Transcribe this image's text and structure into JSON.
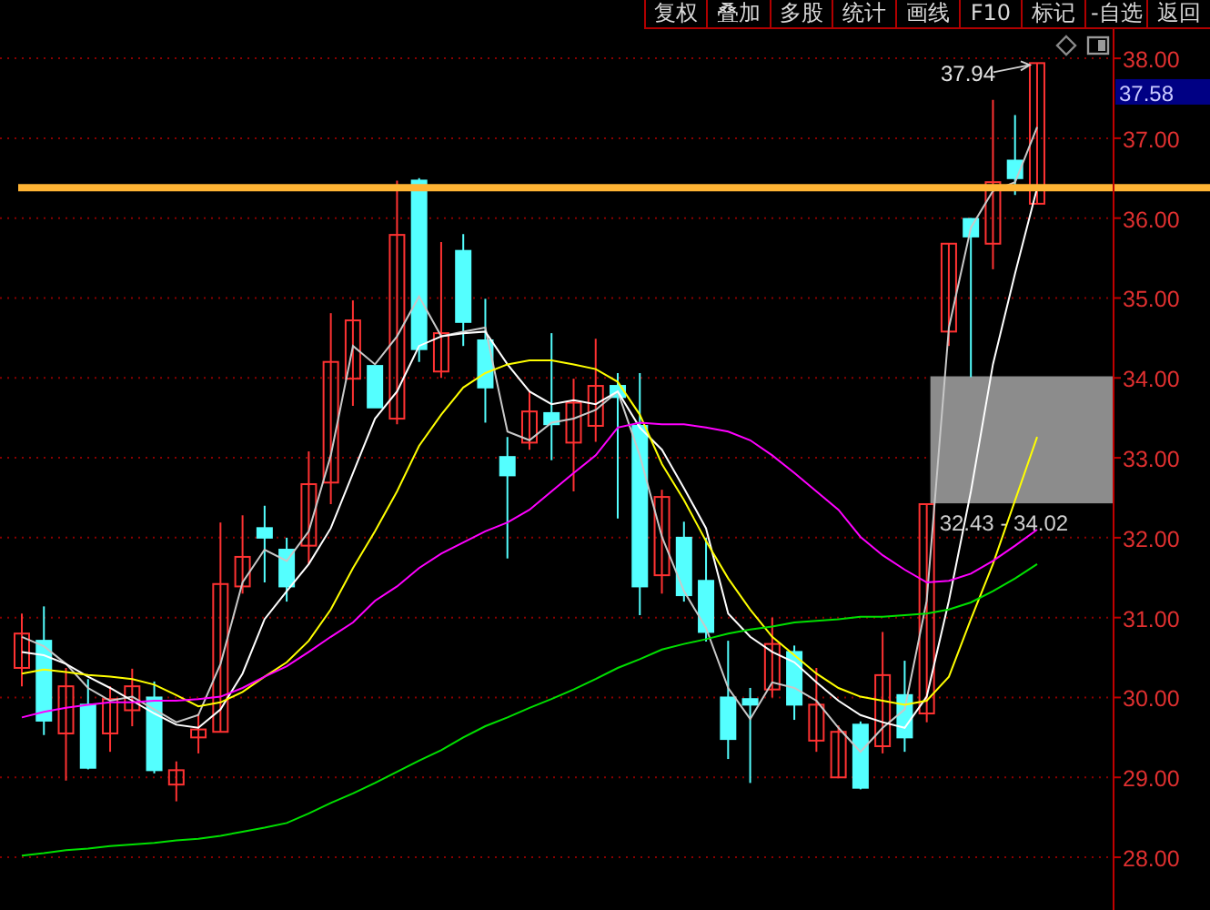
{
  "toolbar": [
    "复权",
    "叠加",
    "多股",
    "统计",
    "画线",
    "F10",
    "标记",
    "-自选",
    "返回"
  ],
  "chart_data": {
    "type": "candlestick",
    "ylim": [
      27.34,
      38.73
    ],
    "grid": true,
    "ref_lines": [
      {
        "axis": "y",
        "value": 36.38,
        "color": "#ffb434"
      }
    ],
    "bands": [
      {
        "axis": "y",
        "from": 32.43,
        "to": 34.02,
        "label": "32.43 - 34.02"
      }
    ],
    "yticks": [
      {
        "value": 28,
        "label": "28.00"
      },
      {
        "value": 29,
        "label": "29.00"
      },
      {
        "value": 30,
        "label": "30.00"
      },
      {
        "value": 31,
        "label": "31.00"
      },
      {
        "value": 32,
        "label": "32.00"
      },
      {
        "value": 33,
        "label": "33.00"
      },
      {
        "value": 34,
        "label": "34.00"
      },
      {
        "value": 35,
        "label": "35.00"
      },
      {
        "value": 36,
        "label": "36.00"
      },
      {
        "value": 37,
        "label": "37.00"
      },
      {
        "value": 38,
        "label": "38.00"
      }
    ],
    "ohlc": [
      [
        30.37,
        31.05,
        30.14,
        30.8
      ],
      [
        30.71,
        31.14,
        29.53,
        29.71
      ],
      [
        29.55,
        30.37,
        28.96,
        30.14
      ],
      [
        29.91,
        30.23,
        29.1,
        29.12
      ],
      [
        29.55,
        30.14,
        29.32,
        29.98
      ],
      [
        29.84,
        30.36,
        29.64,
        30.14
      ],
      [
        30.0,
        30.2,
        29.05,
        29.09
      ],
      [
        28.91,
        29.2,
        28.7,
        29.09
      ],
      [
        29.5,
        29.8,
        29.3,
        29.6
      ],
      [
        29.57,
        32.19,
        29.57,
        31.42
      ],
      [
        31.39,
        32.28,
        31.3,
        31.76
      ],
      [
        32.12,
        32.4,
        31.44,
        32.0
      ],
      [
        31.85,
        32.0,
        31.2,
        31.39
      ],
      [
        31.9,
        33.08,
        31.67,
        32.67
      ],
      [
        32.69,
        34.81,
        32.42,
        34.2
      ],
      [
        33.99,
        34.97,
        33.65,
        34.72
      ],
      [
        34.15,
        34.15,
        33.63,
        33.63
      ],
      [
        33.49,
        36.47,
        33.42,
        35.79
      ],
      [
        36.47,
        36.5,
        34.2,
        34.36
      ],
      [
        34.08,
        35.7,
        34.0,
        34.56
      ],
      [
        35.59,
        35.8,
        34.4,
        34.7
      ],
      [
        34.47,
        34.99,
        33.44,
        33.88
      ],
      [
        33.01,
        33.26,
        31.74,
        32.78
      ],
      [
        33.19,
        33.84,
        33.1,
        33.58
      ],
      [
        33.56,
        34.56,
        32.97,
        33.42
      ],
      [
        33.19,
        33.99,
        32.58,
        33.69
      ],
      [
        33.4,
        34.49,
        33.2,
        33.9
      ],
      [
        33.9,
        34.06,
        32.24,
        33.76
      ],
      [
        33.4,
        34.06,
        31.03,
        31.39
      ],
      [
        31.53,
        32.6,
        31.3,
        32.51
      ],
      [
        32.0,
        32.2,
        31.2,
        31.28
      ],
      [
        31.46,
        32.0,
        30.7,
        30.82
      ],
      [
        30.0,
        30.71,
        29.23,
        29.48
      ],
      [
        29.98,
        30.12,
        28.93,
        29.91
      ],
      [
        30.1,
        31.0,
        30.0,
        30.67
      ],
      [
        30.57,
        30.65,
        29.72,
        29.91
      ],
      [
        29.46,
        30.37,
        29.32,
        29.91
      ],
      [
        29.0,
        29.65,
        28.99,
        29.57
      ],
      [
        29.66,
        29.7,
        28.85,
        28.87
      ],
      [
        29.39,
        30.82,
        29.3,
        30.28
      ],
      [
        30.03,
        30.46,
        29.32,
        29.5
      ],
      [
        29.8,
        32.42,
        29.69,
        32.42
      ],
      [
        34.58,
        35.68,
        34.4,
        35.68
      ],
      [
        35.99,
        36.0,
        34.01,
        35.77
      ],
      [
        35.68,
        37.48,
        35.36,
        36.45
      ],
      [
        36.72,
        37.29,
        36.29,
        36.5
      ],
      [
        36.18,
        37.94,
        36.18,
        37.94
      ]
    ],
    "series": [
      {
        "type": "line",
        "color": "#c8c8c8",
        "values": [
          30.76,
          30.64,
          30.42,
          30.12,
          29.96,
          30.01,
          29.85,
          29.69,
          29.78,
          30.42,
          31.44,
          31.85,
          31.71,
          32.08,
          33.03,
          34.4,
          34.17,
          34.52,
          35.02,
          34.52,
          34.58,
          34.63,
          33.33,
          33.22,
          33.44,
          33.49,
          33.6,
          33.83,
          33.03,
          32.01,
          31.33,
          30.87,
          30.12,
          29.73,
          30.19,
          30.12,
          29.96,
          29.62,
          29.32,
          29.62,
          29.85,
          31.21,
          34.63,
          35.88,
          36.34,
          36.45,
          37.14
        ]
      },
      {
        "type": "line",
        "color": "#ffffff",
        "values": [
          30.57,
          30.53,
          30.42,
          30.26,
          30.12,
          29.96,
          29.8,
          29.66,
          29.62,
          29.85,
          30.3,
          30.98,
          31.33,
          31.67,
          32.12,
          32.81,
          33.49,
          33.83,
          34.4,
          34.52,
          34.56,
          34.58,
          34.17,
          33.83,
          33.67,
          33.72,
          33.67,
          33.83,
          33.38,
          33.1,
          32.62,
          32.12,
          31.05,
          30.76,
          30.57,
          30.44,
          30.19,
          29.96,
          29.78,
          29.69,
          29.62,
          30.01,
          31.21,
          32.58,
          34.17,
          35.31,
          36.38
        ]
      },
      {
        "type": "line",
        "color": "#ffff00",
        "values": [
          30.3,
          30.35,
          30.32,
          30.28,
          30.26,
          30.23,
          30.16,
          30.03,
          29.89,
          29.94,
          30.07,
          30.26,
          30.44,
          30.71,
          31.1,
          31.62,
          32.08,
          32.58,
          33.15,
          33.54,
          33.88,
          34.06,
          34.17,
          34.22,
          34.22,
          34.17,
          34.11,
          33.95,
          33.54,
          32.92,
          32.47,
          31.96,
          31.49,
          31.1,
          30.76,
          30.53,
          30.3,
          30.12,
          30.01,
          29.96,
          29.91,
          29.96,
          30.26,
          30.98,
          31.67,
          32.47,
          33.26
        ]
      },
      {
        "type": "line",
        "color": "#ff00ff",
        "values": [
          29.75,
          29.82,
          29.87,
          29.91,
          29.94,
          29.94,
          29.96,
          29.96,
          29.98,
          30.01,
          30.12,
          30.26,
          30.39,
          30.57,
          30.76,
          30.94,
          31.21,
          31.39,
          31.62,
          31.8,
          31.94,
          32.08,
          32.19,
          32.35,
          32.58,
          32.81,
          33.03,
          33.38,
          33.44,
          33.42,
          33.42,
          33.38,
          33.33,
          33.22,
          33.03,
          32.81,
          32.58,
          32.35,
          32.01,
          31.78,
          31.6,
          31.44,
          31.46,
          31.55,
          31.71,
          31.9,
          32.1
        ]
      },
      {
        "type": "line",
        "color": "#00e000",
        "values": [
          28.02,
          28.05,
          28.09,
          28.11,
          28.14,
          28.16,
          28.18,
          28.21,
          28.23,
          28.27,
          28.32,
          28.37,
          28.43,
          28.55,
          28.68,
          28.8,
          28.93,
          29.07,
          29.21,
          29.34,
          29.5,
          29.64,
          29.75,
          29.87,
          29.98,
          30.1,
          30.23,
          30.37,
          30.48,
          30.6,
          30.67,
          30.73,
          30.8,
          30.85,
          30.89,
          30.94,
          30.96,
          30.98,
          31.01,
          31.01,
          31.03,
          31.05,
          31.1,
          31.19,
          31.33,
          31.49,
          31.67
        ]
      }
    ],
    "annotations": [
      {
        "text": "37.94"
      },
      {
        "text": "37.58"
      }
    ]
  }
}
